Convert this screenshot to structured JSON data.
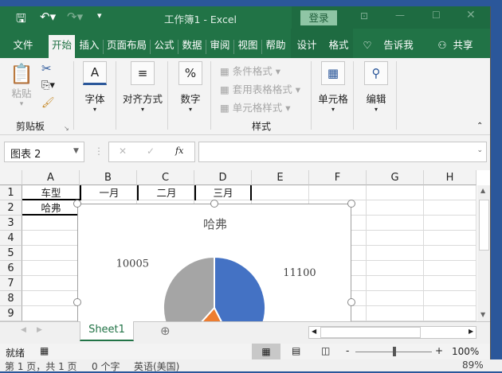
{
  "titlebar": {
    "title": "工作簿1  -  Excel",
    "login": "登录"
  },
  "tabs": [
    {
      "label": "文件"
    },
    {
      "label": "开始",
      "active": true
    },
    {
      "label": "插入"
    },
    {
      "label": "页面布局"
    },
    {
      "label": "公式"
    },
    {
      "label": "数据"
    },
    {
      "label": "审阅"
    },
    {
      "label": "视图"
    },
    {
      "label": "帮助"
    },
    {
      "label": "设计"
    },
    {
      "label": "格式"
    },
    {
      "label": "告诉我"
    },
    {
      "label": "共享"
    }
  ],
  "ribbon": {
    "paste": "粘贴",
    "clipboard": "剪贴板",
    "font": "字体",
    "align": "对齐方式",
    "number": "数字",
    "cond_format": "条件格式",
    "table_format": "套用表格格式",
    "cell_style": "单元格样式",
    "styles": "样式",
    "cells": "单元格",
    "editing": "编辑"
  },
  "formula_bar": {
    "name_box": "图表 2",
    "fx": "fx",
    "value": ""
  },
  "columns": [
    "A",
    "B",
    "C",
    "D",
    "E",
    "F",
    "G",
    "H"
  ],
  "rows": [
    "1",
    "2",
    "3",
    "4",
    "5",
    "6",
    "7",
    "8",
    "9"
  ],
  "cells": {
    "A1": "车型",
    "B1": "一月",
    "C1": "二月",
    "D1": "三月",
    "A2": "哈弗"
  },
  "chart_data": {
    "type": "pie",
    "title": "哈弗",
    "categories": [
      "一月",
      "二月",
      "三月"
    ],
    "values": [
      11100,
      5000,
      10005
    ],
    "colors": [
      "#4472c4",
      "#ed7d31",
      "#a5a5a5"
    ],
    "data_labels": [
      "11100",
      "",
      "10005"
    ]
  },
  "sheets": [
    {
      "label": "Sheet1",
      "active": true
    }
  ],
  "status": {
    "ready": "就绪",
    "zoom": "100%"
  },
  "word_status": {
    "page": "第 1 页，共 1 页",
    "words": "0 个字",
    "lang": "英语(美国)",
    "zoom": "89%"
  }
}
